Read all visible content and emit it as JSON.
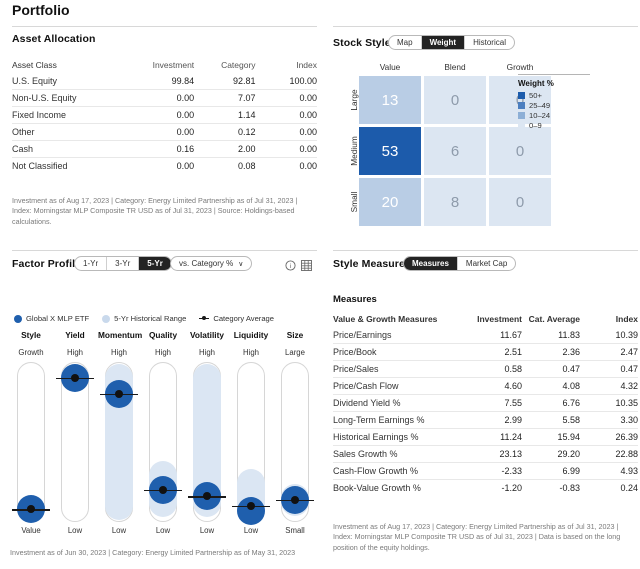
{
  "page_title": "Portfolio",
  "asset_allocation": {
    "title": "Asset Allocation",
    "columns": [
      "Asset Class",
      "Investment",
      "Category",
      "Index"
    ],
    "rows": [
      {
        "label": "U.S. Equity",
        "investment": "99.84",
        "category": "92.81",
        "index": "100.00"
      },
      {
        "label": "Non-U.S. Equity",
        "investment": "0.00",
        "category": "7.07",
        "index": "0.00"
      },
      {
        "label": "Fixed Income",
        "investment": "0.00",
        "category": "1.14",
        "index": "0.00"
      },
      {
        "label": "Other",
        "investment": "0.00",
        "category": "0.12",
        "index": "0.00"
      },
      {
        "label": "Cash",
        "investment": "0.16",
        "category": "2.00",
        "index": "0.00"
      },
      {
        "label": "Not Classified",
        "investment": "0.00",
        "category": "0.08",
        "index": "0.00"
      }
    ],
    "footnote": "Investment as of Aug 17, 2023 | Category: Energy Limited Partnership as of Jul 31, 2023 | Index: Morningstar MLP Composite TR USD as of Jul 31, 2023 | Source: Holdings-based calculations."
  },
  "stock_style": {
    "title": "Stock Style",
    "tabs": [
      {
        "label": "Map",
        "active": false
      },
      {
        "label": "Weight",
        "active": true
      },
      {
        "label": "Historical",
        "active": false
      }
    ],
    "col_headers": [
      "Value",
      "Blend",
      "Growth"
    ],
    "row_headers": [
      "Large",
      "Medium",
      "Small"
    ],
    "cells": [
      [
        {
          "value": "13",
          "level": "lvl-10"
        },
        {
          "value": "0",
          "level": "lvl-0"
        },
        {
          "value": "0",
          "level": "lvl-0"
        }
      ],
      [
        {
          "value": "53",
          "level": "lvl-50"
        },
        {
          "value": "6",
          "level": "lvl-0"
        },
        {
          "value": "0",
          "level": "lvl-0"
        }
      ],
      [
        {
          "value": "20",
          "level": "lvl-10"
        },
        {
          "value": "8",
          "level": "lvl-0"
        },
        {
          "value": "0",
          "level": "lvl-0"
        }
      ]
    ],
    "legend": {
      "title": "Weight %",
      "items": [
        {
          "label": "50+",
          "color": "#1c5bab"
        },
        {
          "label": "25–49",
          "color": "#4c7fc0"
        },
        {
          "label": "10–24",
          "color": "#8dafd6"
        },
        {
          "label": "0–9",
          "color": "#dce6f2"
        }
      ]
    }
  },
  "factor_profile": {
    "title": "Factor Profile",
    "range_tabs": [
      {
        "label": "1-Yr",
        "active": false
      },
      {
        "label": "3-Yr",
        "active": false
      },
      {
        "label": "5-Yr",
        "active": true
      }
    ],
    "compare_label": "vs. Category %",
    "compare_caret": "∨",
    "info_icon": "info-circle-icon",
    "table_icon": "table-view-icon",
    "legend": [
      {
        "label": "Global X MLP ETF",
        "type": "investment"
      },
      {
        "label": "5-Yr Historical Range",
        "type": "range"
      },
      {
        "label": "Category Average",
        "type": "average"
      }
    ],
    "factors": [
      {
        "name": "Style",
        "top": "Growth",
        "bottom": "Value",
        "investment_pct": 8,
        "range_top_pct": 14,
        "range_bottom_pct": 2,
        "category_avg_pct": 8
      },
      {
        "name": "Yield",
        "top": "High",
        "bottom": "Low",
        "investment_pct": 90,
        "range_top_pct": 98,
        "range_bottom_pct": 84,
        "category_avg_pct": 90
      },
      {
        "name": "Momentum",
        "top": "High",
        "bottom": "Low",
        "investment_pct": 80,
        "range_top_pct": 99,
        "range_bottom_pct": 1,
        "category_avg_pct": 80
      },
      {
        "name": "Quality",
        "top": "High",
        "bottom": "Low",
        "investment_pct": 20,
        "range_top_pct": 38,
        "range_bottom_pct": 3,
        "category_avg_pct": 20
      },
      {
        "name": "Volatility",
        "top": "High",
        "bottom": "Low",
        "investment_pct": 16,
        "range_top_pct": 99,
        "range_bottom_pct": 3,
        "category_avg_pct": 16
      },
      {
        "name": "Liquidity",
        "top": "High",
        "bottom": "Low",
        "investment_pct": 7,
        "range_top_pct": 33,
        "range_bottom_pct": 1,
        "category_avg_pct": 10
      },
      {
        "name": "Size",
        "top": "Large",
        "bottom": "Small",
        "investment_pct": 14,
        "range_top_pct": 24,
        "range_bottom_pct": 4,
        "category_avg_pct": 14
      }
    ],
    "footnote": "Investment as of Jun 30, 2023 | Category: Energy Limited Partnership as of May 31, 2023"
  },
  "style_measures": {
    "title": "Style Measures",
    "tabs": [
      {
        "label": "Measures",
        "active": true
      },
      {
        "label": "Market Cap",
        "active": false
      }
    ],
    "subtitle": "Measures",
    "columns": [
      "Value & Growth Measures",
      "Investment",
      "Cat. Average",
      "Index"
    ],
    "rows": [
      {
        "label": "Price/Earnings",
        "investment": "11.67",
        "cat_average": "11.83",
        "index": "10.39"
      },
      {
        "label": "Price/Book",
        "investment": "2.51",
        "cat_average": "2.36",
        "index": "2.47"
      },
      {
        "label": "Price/Sales",
        "investment": "0.58",
        "cat_average": "0.47",
        "index": "0.47"
      },
      {
        "label": "Price/Cash Flow",
        "investment": "4.60",
        "cat_average": "4.08",
        "index": "4.32"
      },
      {
        "label": "Dividend Yield %",
        "investment": "7.55",
        "cat_average": "6.76",
        "index": "10.35"
      },
      {
        "label": "Long-Term Earnings %",
        "investment": "2.99",
        "cat_average": "5.58",
        "index": "3.30"
      },
      {
        "label": "Historical Earnings %",
        "investment": "11.24",
        "cat_average": "15.94",
        "index": "26.39"
      },
      {
        "label": "Sales Growth %",
        "investment": "23.13",
        "cat_average": "29.20",
        "index": "22.88"
      },
      {
        "label": "Cash-Flow Growth %",
        "investment": "-2.33",
        "cat_average": "6.99",
        "index": "4.93"
      },
      {
        "label": "Book-Value Growth %",
        "investment": "-1.20",
        "cat_average": "-0.83",
        "index": "0.24"
      }
    ],
    "footnote": "Investment as of Aug 17, 2023 | Category: Energy Limited Partnership as of Jul 31, 2023 | Index: Morningstar MLP Composite TR USD as of Jul 31, 2023 | Data is based on the long position of the equity holdings."
  },
  "chart_data": {
    "type": "table",
    "title": "Portfolio",
    "stock_style_box": {
      "type": "heatmap",
      "title": "Stock Style — Weight %",
      "x": [
        "Value",
        "Blend",
        "Growth"
      ],
      "y": [
        "Large",
        "Medium",
        "Small"
      ],
      "values": [
        [
          13,
          0,
          0
        ],
        [
          53,
          6,
          0
        ],
        [
          20,
          8,
          0
        ]
      ],
      "legend_bins": [
        "50+",
        "25–49",
        "10–24",
        "0–9"
      ]
    },
    "factor_profile_chart": {
      "type": "scatter",
      "title": "Factor Profile (5-Yr, vs. Category %)",
      "categories": [
        "Style",
        "Yield",
        "Momentum",
        "Quality",
        "Volatility",
        "Liquidity",
        "Size"
      ],
      "axis_top_labels": [
        "Growth",
        "High",
        "High",
        "High",
        "High",
        "High",
        "Large"
      ],
      "axis_bottom_labels": [
        "Value",
        "Low",
        "Low",
        "Low",
        "Low",
        "Low",
        "Small"
      ],
      "ylim": [
        0,
        100
      ],
      "series": [
        {
          "name": "Global X MLP ETF",
          "values": [
            8,
            90,
            80,
            20,
            16,
            7,
            14
          ]
        },
        {
          "name": "Category Average",
          "values": [
            8,
            90,
            80,
            20,
            16,
            10,
            14
          ]
        },
        {
          "name": "5-Yr Historical Range high",
          "values": [
            14,
            98,
            99,
            38,
            99,
            33,
            24
          ]
        },
        {
          "name": "5-Yr Historical Range low",
          "values": [
            2,
            84,
            1,
            3,
            3,
            1,
            4
          ]
        }
      ]
    },
    "asset_allocation_table": {
      "type": "table",
      "columns": [
        "Asset Class",
        "Investment",
        "Category",
        "Index"
      ],
      "rows": [
        [
          "U.S. Equity",
          99.84,
          92.81,
          100.0
        ],
        [
          "Non-U.S. Equity",
          0.0,
          7.07,
          0.0
        ],
        [
          "Fixed Income",
          0.0,
          1.14,
          0.0
        ],
        [
          "Other",
          0.0,
          0.12,
          0.0
        ],
        [
          "Cash",
          0.16,
          2.0,
          0.0
        ],
        [
          "Not Classified",
          0.0,
          0.08,
          0.0
        ]
      ]
    },
    "style_measures_table": {
      "type": "table",
      "columns": [
        "Value & Growth Measures",
        "Investment",
        "Cat. Average",
        "Index"
      ],
      "rows": [
        [
          "Price/Earnings",
          11.67,
          11.83,
          10.39
        ],
        [
          "Price/Book",
          2.51,
          2.36,
          2.47
        ],
        [
          "Price/Sales",
          0.58,
          0.47,
          0.47
        ],
        [
          "Price/Cash Flow",
          4.6,
          4.08,
          4.32
        ],
        [
          "Dividend Yield %",
          7.55,
          6.76,
          10.35
        ],
        [
          "Long-Term Earnings %",
          2.99,
          5.58,
          3.3
        ],
        [
          "Historical Earnings %",
          11.24,
          15.94,
          26.39
        ],
        [
          "Sales Growth %",
          23.13,
          29.2,
          22.88
        ],
        [
          "Cash-Flow Growth %",
          -2.33,
          6.99,
          4.93
        ],
        [
          "Book-Value Growth %",
          -1.2,
          -0.83,
          0.24
        ]
      ]
    }
  }
}
